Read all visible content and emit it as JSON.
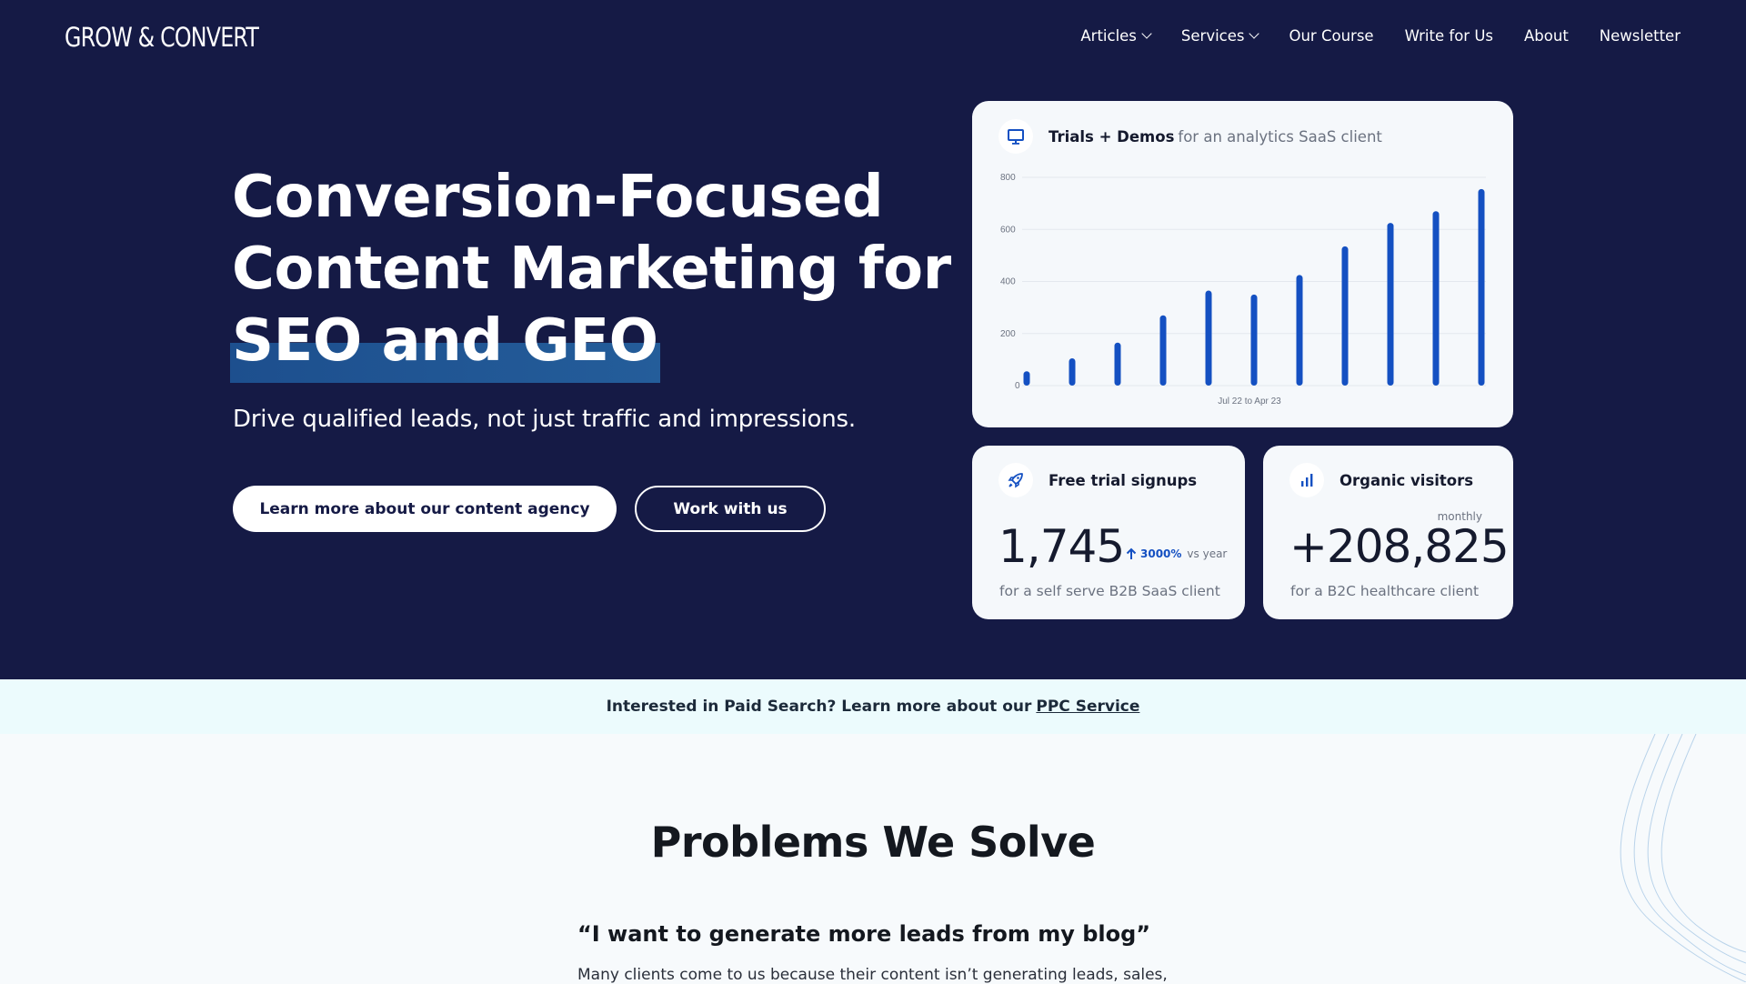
{
  "brand": {
    "logo": "GROW & CONVERT"
  },
  "nav": {
    "items": [
      {
        "label": "Articles",
        "has_dropdown": true
      },
      {
        "label": "Services",
        "has_dropdown": true
      },
      {
        "label": "Our Course",
        "has_dropdown": false
      },
      {
        "label": "Write for Us",
        "has_dropdown": false
      },
      {
        "label": "About",
        "has_dropdown": false
      },
      {
        "label": "Newsletter",
        "has_dropdown": false
      }
    ]
  },
  "hero": {
    "headline_line1": "Conversion-Focused",
    "headline_line2": "Content Marketing for",
    "headline_highlight": "SEO and GEO",
    "subheadline": "Drive qualified leads, not just traffic and impressions.",
    "primary_button": "Learn more about our content agency",
    "secondary_button": "Work with us"
  },
  "chart_card": {
    "title": "Trials + Demos",
    "subtitle": "for an analytics SaaS client",
    "icon": "monitor-icon"
  },
  "chart_data": {
    "type": "bar",
    "title": "Trials + Demos",
    "subtitle": "for an analytics SaaS client",
    "xlabel": "Jul 22 to Apr 23",
    "ylabel": "",
    "yticks": [
      0,
      200,
      400,
      600,
      800
    ],
    "ylim": [
      0,
      800
    ],
    "values": [
      55,
      105,
      165,
      270,
      365,
      350,
      425,
      535,
      625,
      670,
      755
    ],
    "grid": true,
    "bar_color": "#1450c2"
  },
  "stat_trials": {
    "icon": "rocket-icon",
    "title": "Free trial signups",
    "value": "1,745",
    "growth": "3000%",
    "growth_suffix": "vs year",
    "caption": "for a self serve B2B SaaS client"
  },
  "stat_visitors": {
    "icon": "bar-chart-icon",
    "title": "Organic visitors",
    "period": "monthly",
    "value": "+208,825",
    "caption": "for a B2C healthcare client"
  },
  "ppc_banner": {
    "text": "Interested in Paid Search? Learn more about our",
    "link": "PPC Service"
  },
  "problems": {
    "title": "Problems We Solve",
    "quote": "“I want to generate more leads from my blog”",
    "body": "Many clients come to us because their content isn’t generating leads, sales,"
  },
  "colors": {
    "hero_bg": "#151a45",
    "accent_blue": "#1450c2",
    "highlight": "#1d4f8e",
    "ppc_bg": "#ecfbfd"
  }
}
